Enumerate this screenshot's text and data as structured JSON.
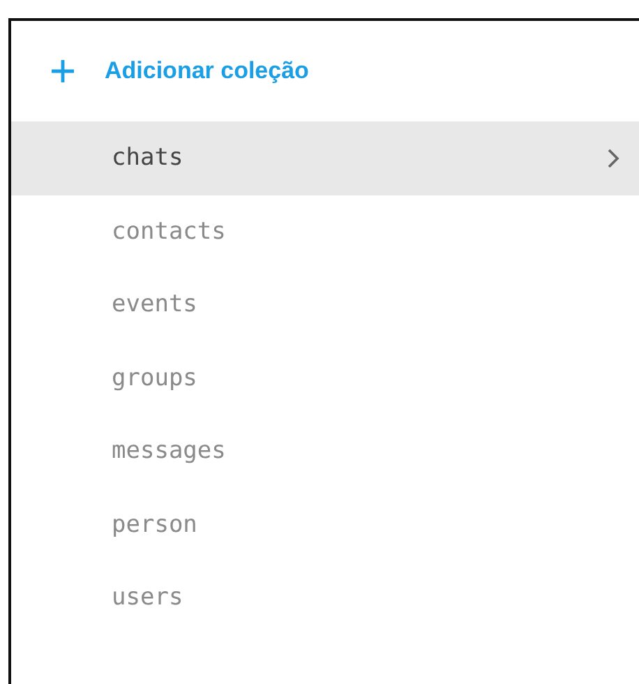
{
  "add_button": {
    "label": "Adicionar coleção"
  },
  "collections": [
    {
      "name": "chats",
      "selected": true
    },
    {
      "name": "contacts",
      "selected": false
    },
    {
      "name": "events",
      "selected": false
    },
    {
      "name": "groups",
      "selected": false
    },
    {
      "name": "messages",
      "selected": false
    },
    {
      "name": "person",
      "selected": false
    },
    {
      "name": "users",
      "selected": false
    }
  ]
}
